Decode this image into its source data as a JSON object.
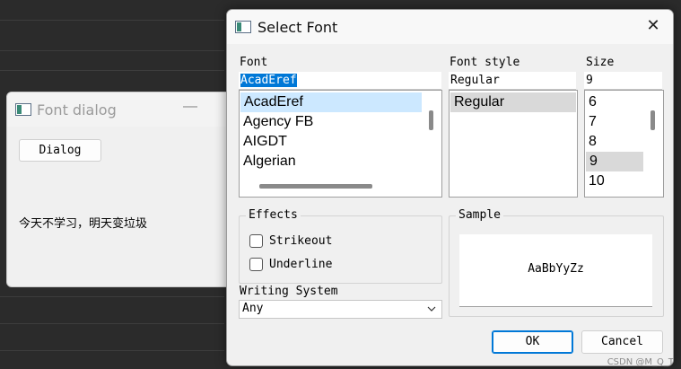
{
  "background_window": {
    "title": "Font dialog",
    "minimize_glyph": "—",
    "dialog_button": "Dialog",
    "body_text": "今天不学习，明天变垃圾"
  },
  "select_font": {
    "title": "Select Font",
    "close_glyph": "✕",
    "font_label": "Font",
    "font_value": "AcadEref",
    "font_items": [
      "AcadEref",
      "Agency FB",
      "AIGDT",
      "Algerian"
    ],
    "style_label": "Font style",
    "style_value": "Regular",
    "style_items": [
      "Regular"
    ],
    "size_label": "Size",
    "size_value": "9",
    "size_items": [
      "6",
      "7",
      "8",
      "9",
      "10"
    ],
    "effects_label": "Effects",
    "strikeout_label": "Strikeout",
    "underline_label": "Underline",
    "strikeout_checked": false,
    "underline_checked": false,
    "sample_label": "Sample",
    "sample_text": "AaBbYyZz",
    "writing_system_label": "Writing System",
    "writing_system_value": "Any",
    "ok_label": "OK",
    "cancel_label": "Cancel"
  },
  "watermark": "CSDN @M_Q_T",
  "colors": {
    "selection_blue": "#0078d7",
    "list_highlight": "#cce8ff",
    "list_gray_highlight": "#d9d9d9"
  }
}
